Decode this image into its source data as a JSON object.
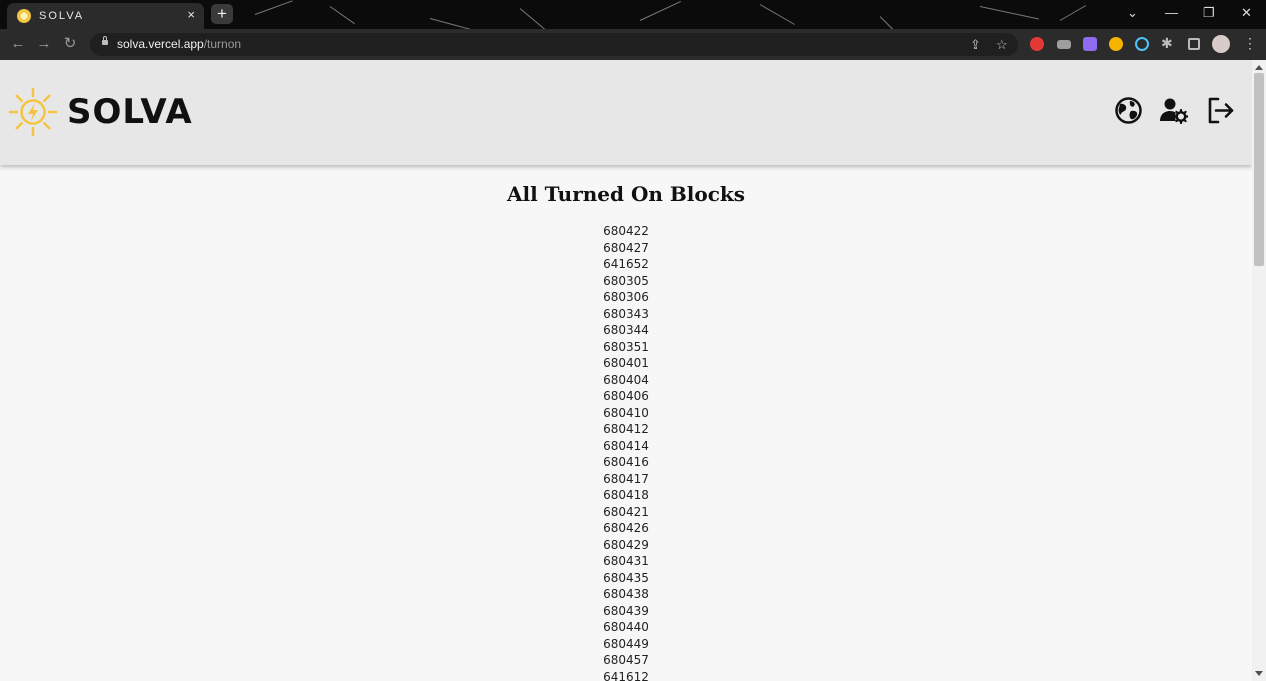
{
  "browser": {
    "tab_title": "SOLVA",
    "url_host": "solva.vercel.app",
    "url_path": "/turnon",
    "new_tab_symbol": "+",
    "close_tab_symbol": "×"
  },
  "header": {
    "logo_text": "SOLVA",
    "accent_color": "#f4c542",
    "icons": [
      "globe-icon",
      "user-settings-icon",
      "logout-icon"
    ]
  },
  "main": {
    "title": "All Turned On Blocks",
    "blocks": [
      "680422",
      "680427",
      "641652",
      "680305",
      "680306",
      "680343",
      "680344",
      "680351",
      "680401",
      "680404",
      "680406",
      "680410",
      "680412",
      "680414",
      "680416",
      "680417",
      "680418",
      "680421",
      "680426",
      "680429",
      "680431",
      "680435",
      "680438",
      "680439",
      "680440",
      "680449",
      "680457",
      "641612"
    ]
  }
}
